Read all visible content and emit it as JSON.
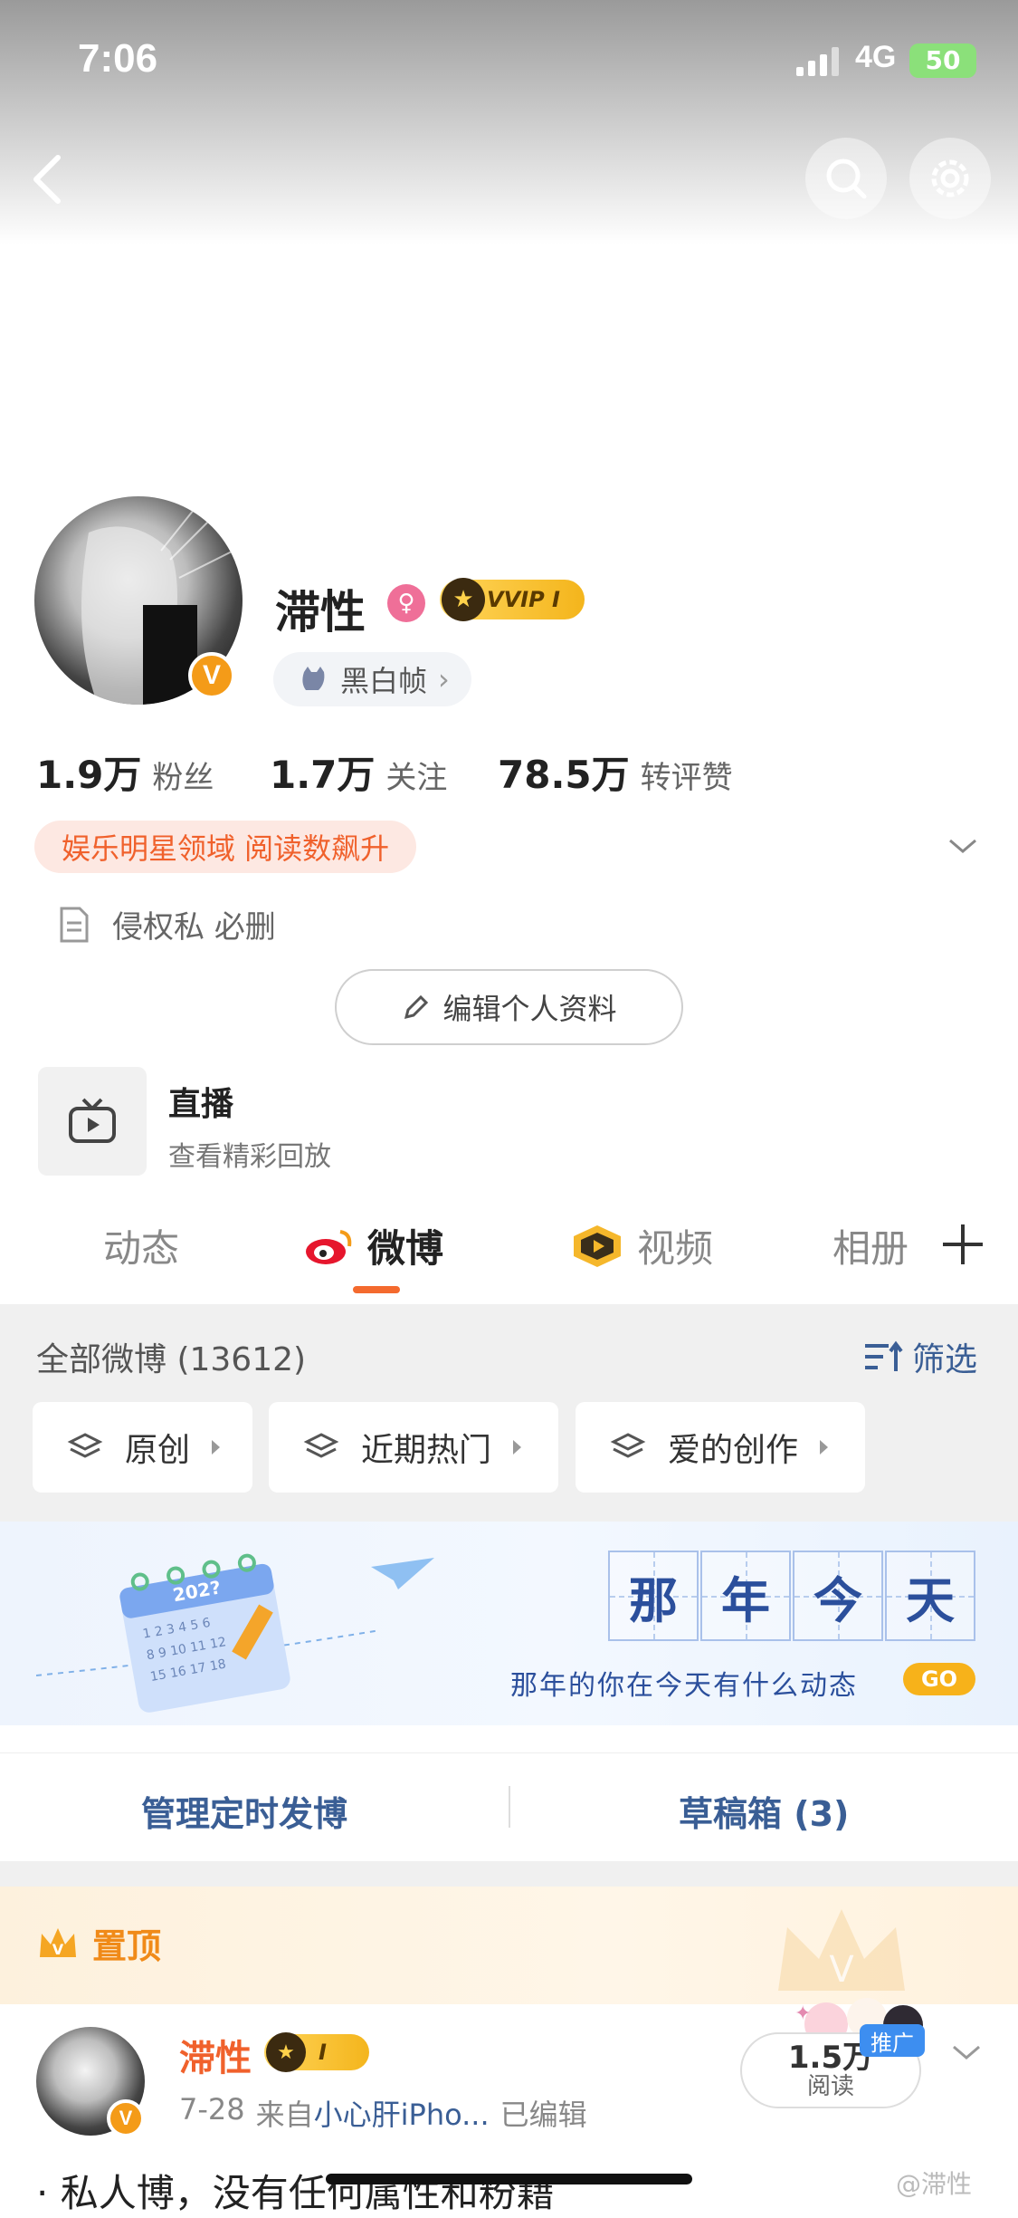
{
  "status_bar": {
    "time": "7:06",
    "network": "4G",
    "battery": "50"
  },
  "profile": {
    "name": "滞性",
    "vip_label": "VVIP I",
    "group_chip": "黑白帧",
    "stats": [
      {
        "value": "1.9万",
        "label": "粉丝"
      },
      {
        "value": "1.7万",
        "label": "关注"
      },
      {
        "value": "78.5万",
        "label": "转评赞"
      }
    ],
    "tag": "娱乐明星领域 阅读数飙升",
    "bio": "侵权私 必删",
    "edit_button": "编辑个人资料"
  },
  "live": {
    "title": "直播",
    "subtitle": "查看精彩回放"
  },
  "tabs": [
    {
      "label": "动态",
      "active": false
    },
    {
      "label": "微博",
      "active": true
    },
    {
      "label": "视频",
      "active": false
    },
    {
      "label": "相册",
      "active": false
    }
  ],
  "feed_header": {
    "all_label": "全部微博 (13612)",
    "filter_label": "筛选"
  },
  "filter_pills": [
    "原创",
    "近期热门",
    "爱的创作"
  ],
  "banner": {
    "title_chars": [
      "那",
      "年",
      "今",
      "天"
    ],
    "subtitle": "那年的你在今天有什么动态",
    "go": "GO",
    "calendar_year": "202?"
  },
  "manage": {
    "scheduled": "管理定时发博",
    "drafts": "草稿箱 (3)"
  },
  "pinned": {
    "label": "置顶",
    "author": "滞性",
    "badge": "I",
    "date": "7-28",
    "source_prefix": "来自",
    "source": "小心肝iPho...",
    "edited": "已编辑",
    "reads_value": "1.5万",
    "reads_label": "阅读",
    "promo": "推广",
    "text": "· 私人博，没有任何属性和粉籍"
  },
  "watermark": "@滞性",
  "colors": {
    "accent": "#f46a2e",
    "link": "#3a5e95",
    "vip_gold": "#f4b51c"
  }
}
